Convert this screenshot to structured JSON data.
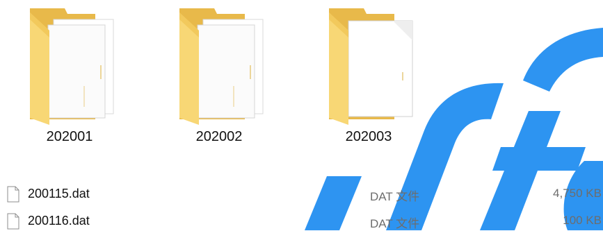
{
  "folders": [
    {
      "name": "202001",
      "icon": "folder-with-documents-icon"
    },
    {
      "name": "202002",
      "icon": "folder-with-documents-icon"
    },
    {
      "name": "202003",
      "icon": "folder-with-document-icon"
    }
  ],
  "files": [
    {
      "name": "200115.dat",
      "type": "DAT 文件",
      "size": "4,750 KB",
      "icon": "file-icon"
    },
    {
      "name": "200116.dat",
      "type": "DAT 文件",
      "size": "100 KB",
      "icon": "file-icon"
    }
  ],
  "colors": {
    "folder_back": "#e8b94a",
    "folder_front": "#f8d775",
    "watermark": "#1e8cf0",
    "text": "#111111",
    "secondary_text": "#6d6d6d"
  }
}
